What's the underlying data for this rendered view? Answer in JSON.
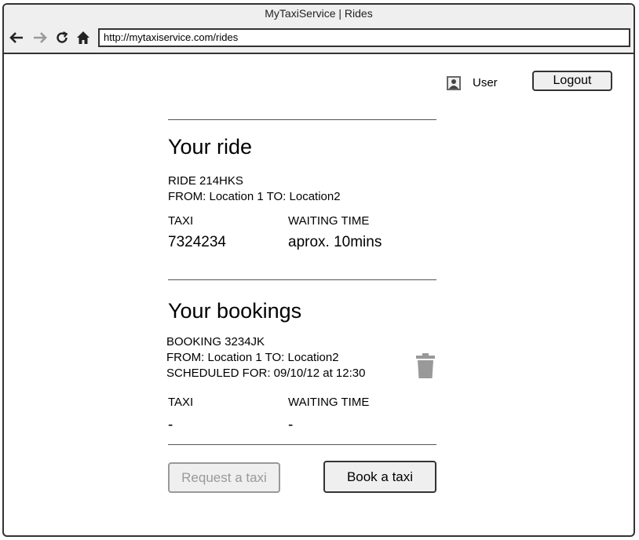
{
  "window": {
    "title": "MyTaxiService | Rides"
  },
  "browser": {
    "url": "http://mytaxiservice.com/rides"
  },
  "header": {
    "user_label": "User",
    "logout_label": "Logout"
  },
  "ride": {
    "heading": "Your ride",
    "code_line": "RIDE 214HKS",
    "route_line": "FROM: Location 1 TO: Location2",
    "taxi_label": "TAXI",
    "taxi_value": "7324234",
    "waiting_label": "WAITING TIME",
    "waiting_value": "aprox. 10mins"
  },
  "bookings": {
    "heading": "Your bookings",
    "items": [
      {
        "code_line": "BOOKING 3234JK",
        "route_line": "FROM: Location 1 TO: Location2",
        "scheduled_line": "SCHEDULED FOR: 09/10/12 at 12:30",
        "taxi_label": "TAXI",
        "taxi_value": "-",
        "waiting_label": "WAITING TIME",
        "waiting_value": "-"
      }
    ]
  },
  "actions": {
    "request_label": "Request a taxi",
    "book_label": "Book a taxi"
  },
  "icons": {
    "back": "back-arrow-icon",
    "forward": "forward-arrow-icon",
    "reload": "reload-icon",
    "home": "home-icon",
    "user": "user-icon",
    "delete": "trash-icon"
  }
}
